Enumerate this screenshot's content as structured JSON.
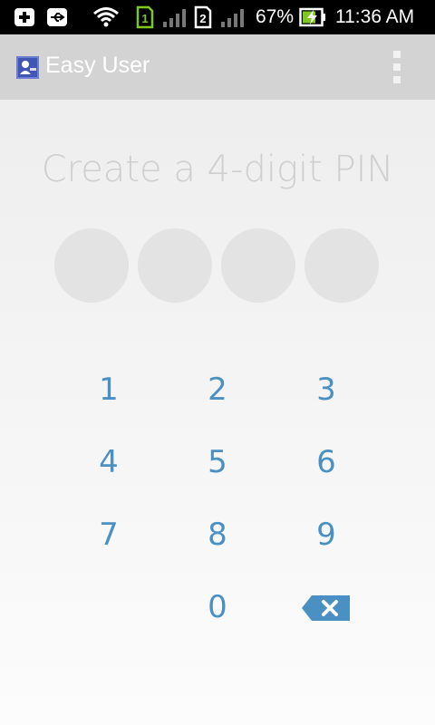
{
  "status_bar": {
    "battery": "67%",
    "time": "11:36 AM",
    "sim1": "1",
    "sim2": "2",
    "icons": [
      "notification-add-icon",
      "usb-icon",
      "wifi-icon",
      "sim1-icon",
      "signal-icon",
      "sim2-icon",
      "signal-icon",
      "battery-charging-icon"
    ]
  },
  "app_bar": {
    "title": "Easy User",
    "menu_icon": "overflow-menu-icon"
  },
  "pin": {
    "prompt": "Create a 4-digit PIN",
    "entered": 0,
    "length": 4
  },
  "keypad": {
    "keys": [
      "1",
      "2",
      "3",
      "4",
      "5",
      "6",
      "7",
      "8",
      "9",
      "0"
    ],
    "backspace_icon": "backspace-icon"
  },
  "colors": {
    "key_text": "#4a90c2",
    "prompt_text": "#cfcfcf",
    "dot_empty": "#e3e3e3",
    "app_bar": "#d3d3d3",
    "backspace": "#4a90c2"
  }
}
